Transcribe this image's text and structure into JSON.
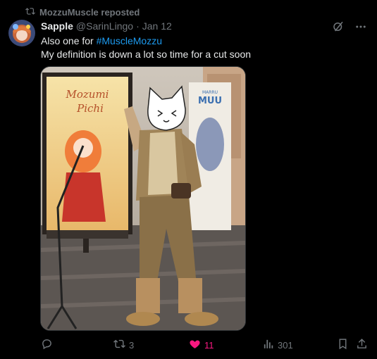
{
  "repost": {
    "label": "MozzuMuscle reposted"
  },
  "tweet": {
    "name": "Sapple",
    "handle": "@SarinLingo",
    "separator": "·",
    "date": "Jan 12",
    "line1_prefix": "Also one for ",
    "hashtag": "#MuscleMozzu",
    "line2": "My definition is down a lot so time for a cut soon"
  },
  "media": {
    "poster_title_1": "Mozumi",
    "poster_title_2": "Pichi",
    "banner_top": "MARRU",
    "banner_text": "MUU"
  },
  "actions": {
    "retweets": "3",
    "likes": "11",
    "views": "301"
  },
  "colors": {
    "like": "#f91880",
    "link": "#1d9bf0",
    "muted": "#71767b"
  },
  "icons": [
    "repost-icon",
    "grok-icon",
    "more-icon",
    "reply-icon",
    "retweet-icon",
    "heart-icon",
    "views-icon",
    "bookmark-icon",
    "share-icon"
  ]
}
